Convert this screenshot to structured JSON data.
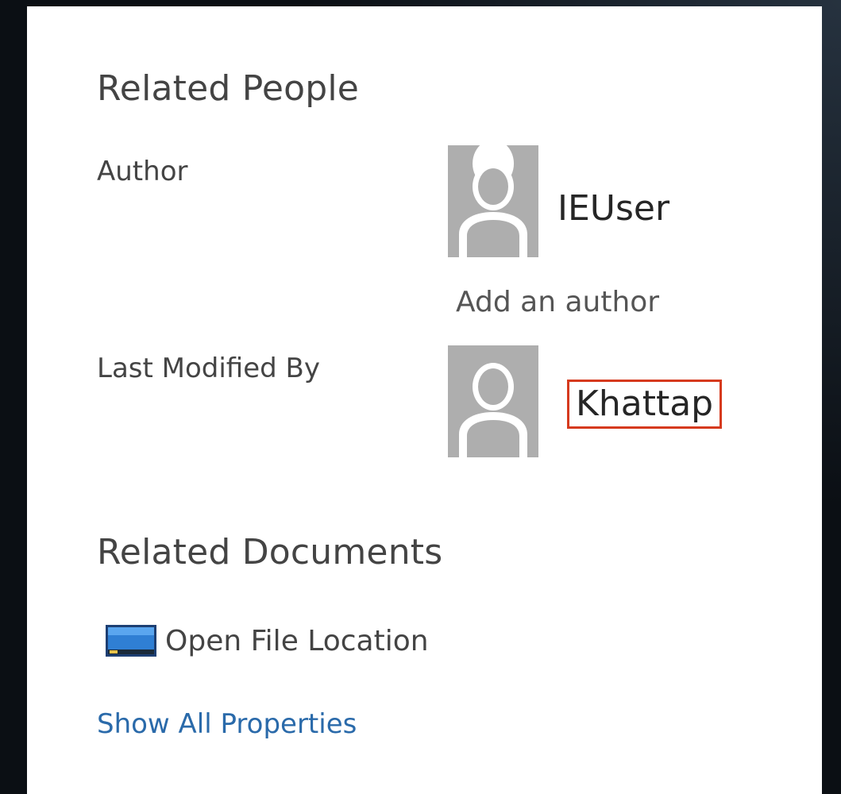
{
  "related_people": {
    "heading": "Related People",
    "author_label": "Author",
    "author_name": "IEUser",
    "add_author": "Add an author",
    "last_modified_label": "Last Modified By",
    "last_modified_name": "Khattap"
  },
  "related_documents": {
    "heading": "Related Documents",
    "open_file_location": "Open File Location",
    "open_file_location_icon": "folder-location-icon"
  },
  "show_all_properties": "Show All Properties",
  "colors": {
    "link": "#2a6aaa",
    "highlight_box": "#d63a1e",
    "avatar_bg": "#aeaeae"
  }
}
